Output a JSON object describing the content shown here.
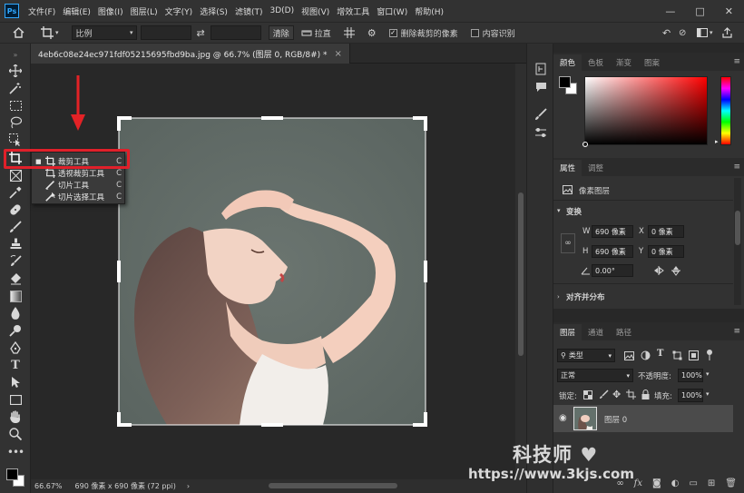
{
  "app": {
    "logo": "Ps"
  },
  "menu": [
    "文件(F)",
    "编辑(E)",
    "图像(I)",
    "图层(L)",
    "文字(Y)",
    "选择(S)",
    "滤镜(T)",
    "3D(D)",
    "视图(V)",
    "增效工具",
    "窗口(W)",
    "帮助(H)"
  ],
  "window_controls": {
    "minimize": "—",
    "maximize": "□",
    "close": "✕"
  },
  "options": {
    "ratio_label": "比例",
    "clear_label": "清除",
    "straighten_label": "拉直",
    "delete_cropped_label": "删除裁剪的像素",
    "delete_cropped_checked": true,
    "content_aware_label": "内容识别",
    "content_aware_checked": false
  },
  "document": {
    "tab_title": "4eb6c08e24ec971fdf05215695fbd9ba.jpg @ 66.7% (图层 0, RGB/8#) *",
    "tab_close": "×"
  },
  "flyout": [
    {
      "label": "裁剪工具",
      "key": "C",
      "active": true,
      "icon": "crop-icon"
    },
    {
      "label": "透视裁剪工具",
      "key": "C",
      "active": false,
      "icon": "perspective-crop-icon"
    },
    {
      "label": "切片工具",
      "key": "C",
      "active": false,
      "icon": "slice-icon"
    },
    {
      "label": "切片选择工具",
      "key": "C",
      "active": false,
      "icon": "slice-select-icon"
    }
  ],
  "status": {
    "zoom": "66.67%",
    "info": "690 像素 x 690 像素 (72 ppi)",
    "arrow": "›"
  },
  "color_panel": {
    "tabs": [
      "颜色",
      "色板",
      "渐变",
      "图案"
    ],
    "active": 0
  },
  "properties_panel": {
    "tabs": [
      "属性",
      "调整"
    ],
    "active": 0,
    "layer_type": "像素图层",
    "transform_label": "变换",
    "w_label": "W",
    "w_value": "690 像素",
    "h_label": "H",
    "h_value": "690 像素",
    "x_label": "X",
    "x_value": "0 像素",
    "y_label": "Y",
    "y_value": "0 像素",
    "angle_value": "0.00°",
    "align_label": "对齐并分布"
  },
  "layers_panel": {
    "tabs": [
      "图层",
      "通道",
      "路径"
    ],
    "active": 0,
    "filter_label": "类型",
    "blend_mode": "正常",
    "opacity_label": "不透明度:",
    "opacity_value": "100%",
    "lock_label": "锁定:",
    "fill_label": "填充:",
    "fill_value": "100%",
    "layer_name": "图层 0"
  },
  "watermark": {
    "name": "科技师",
    "url": "https://www.3kjs.com"
  }
}
